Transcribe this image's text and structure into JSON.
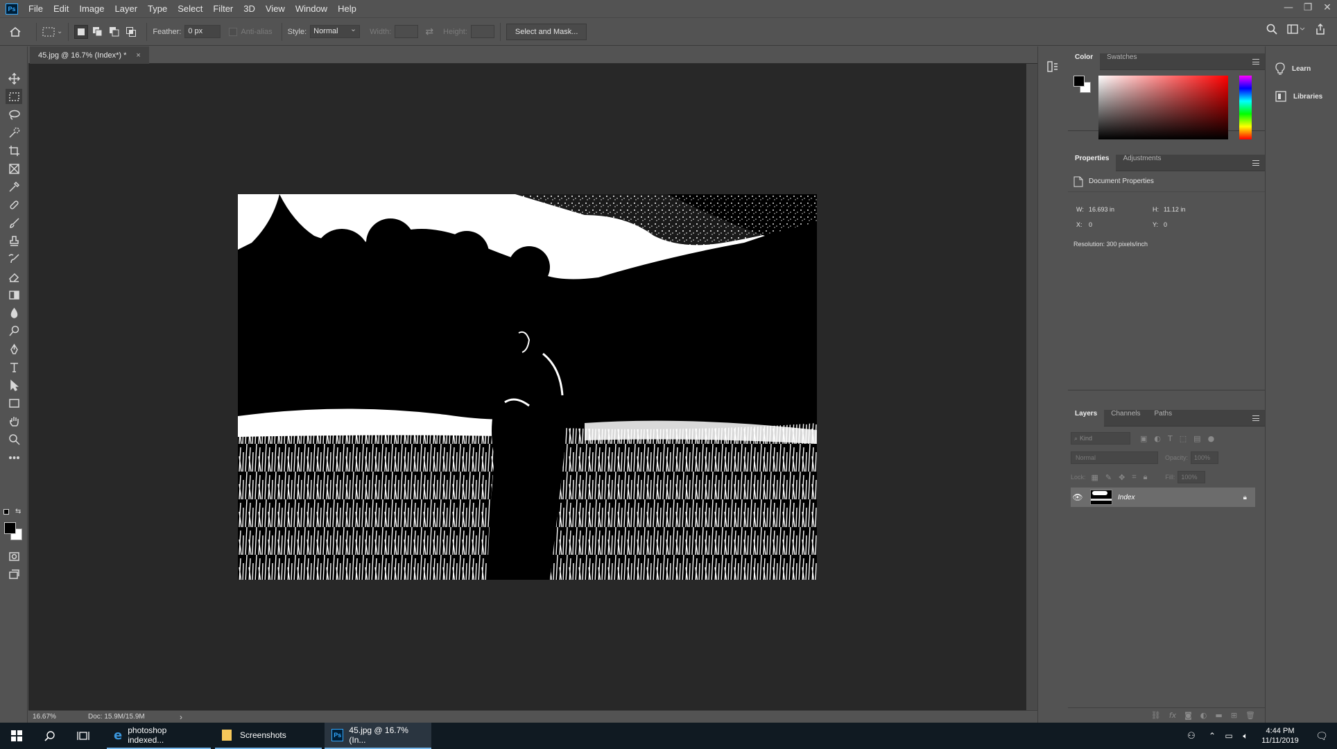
{
  "app": {
    "logo": "Ps"
  },
  "menu": [
    "File",
    "Edit",
    "Image",
    "Layer",
    "Type",
    "Select",
    "Filter",
    "3D",
    "View",
    "Window",
    "Help"
  ],
  "window_controls": {
    "minimize": "—",
    "restore": "❐",
    "close": "✕"
  },
  "options": {
    "feather_label": "Feather:",
    "feather_value": "0 px",
    "antialias_label": "Anti-alias",
    "style_label": "Style:",
    "style_value": "Normal",
    "width_label": "Width:",
    "height_label": "Height:",
    "select_mask": "Select and Mask..."
  },
  "document": {
    "tab_title": "45.jpg @ 16.7% (Index*) *",
    "close": "×",
    "zoom": "16.67%",
    "doc_size": "Doc: 15.9M/15.9M",
    "status_arrow": "›"
  },
  "color_panel": {
    "tabs": [
      "Color",
      "Swatches"
    ],
    "hue_color": "#ff0000"
  },
  "properties_panel": {
    "tabs": [
      "Properties",
      "Adjustments"
    ],
    "section": "Document Properties",
    "w_label": "W:",
    "w_value": "16.693 in",
    "h_label": "H:",
    "h_value": "11.12 in",
    "x_label": "X:",
    "x_value": "0",
    "y_label": "Y:",
    "y_value": "0",
    "resolution": "Resolution: 300 pixels/inch"
  },
  "layers_panel": {
    "tabs": [
      "Layers",
      "Channels",
      "Paths"
    ],
    "kind_placeholder": "Kind",
    "blend_mode": "Normal",
    "opacity_label": "Opacity:",
    "opacity_value": "100%",
    "lock_label": "Lock:",
    "fill_label": "Fill:",
    "fill_value": "100%",
    "layers": [
      {
        "name": "Index",
        "visible": true,
        "locked": true
      }
    ]
  },
  "learn_column": {
    "learn": "Learn",
    "libraries": "Libraries"
  },
  "taskbar": {
    "apps": [
      {
        "label": "photoshop indexed...",
        "icon": "edge-icon"
      },
      {
        "label": "Screenshots",
        "icon": "folder-icon"
      },
      {
        "label": "45.jpg @ 16.7% (In...",
        "icon": "photoshop-icon"
      }
    ],
    "time": "4:44 PM",
    "date": "11/11/2019"
  }
}
